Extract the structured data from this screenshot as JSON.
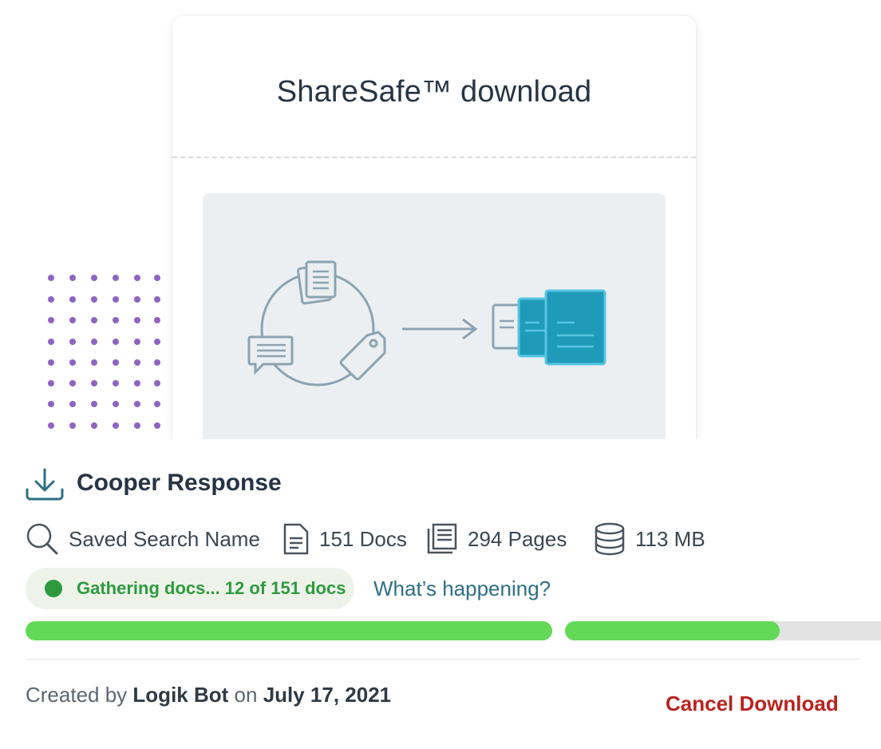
{
  "modal": {
    "title": "ShareSafe™ download"
  },
  "download": {
    "name": "Cooper Response",
    "icon": "download-icon",
    "meta": {
      "search_name": "Saved Search Name",
      "docs": "151 Docs",
      "pages": "294 Pages",
      "size": "113 MB"
    },
    "status": {
      "text": "Gathering docs... 12 of 151 docs",
      "color": "#2e9a3e"
    },
    "help_link": "What’s happening?",
    "progress": {
      "bar1_fraction": 1.0,
      "bar2_fraction": 0.64
    },
    "created": {
      "prefix": "Created by",
      "author": "Logik Bot",
      "on": "on",
      "date": "July 17, 2021"
    },
    "cancel_label": "Cancel Download"
  },
  "colors": {
    "accent_teal": "#1f9ab9",
    "progress_green": "#62d957",
    "danger": "#b8231f",
    "dots_purple": "#8e64c1"
  }
}
